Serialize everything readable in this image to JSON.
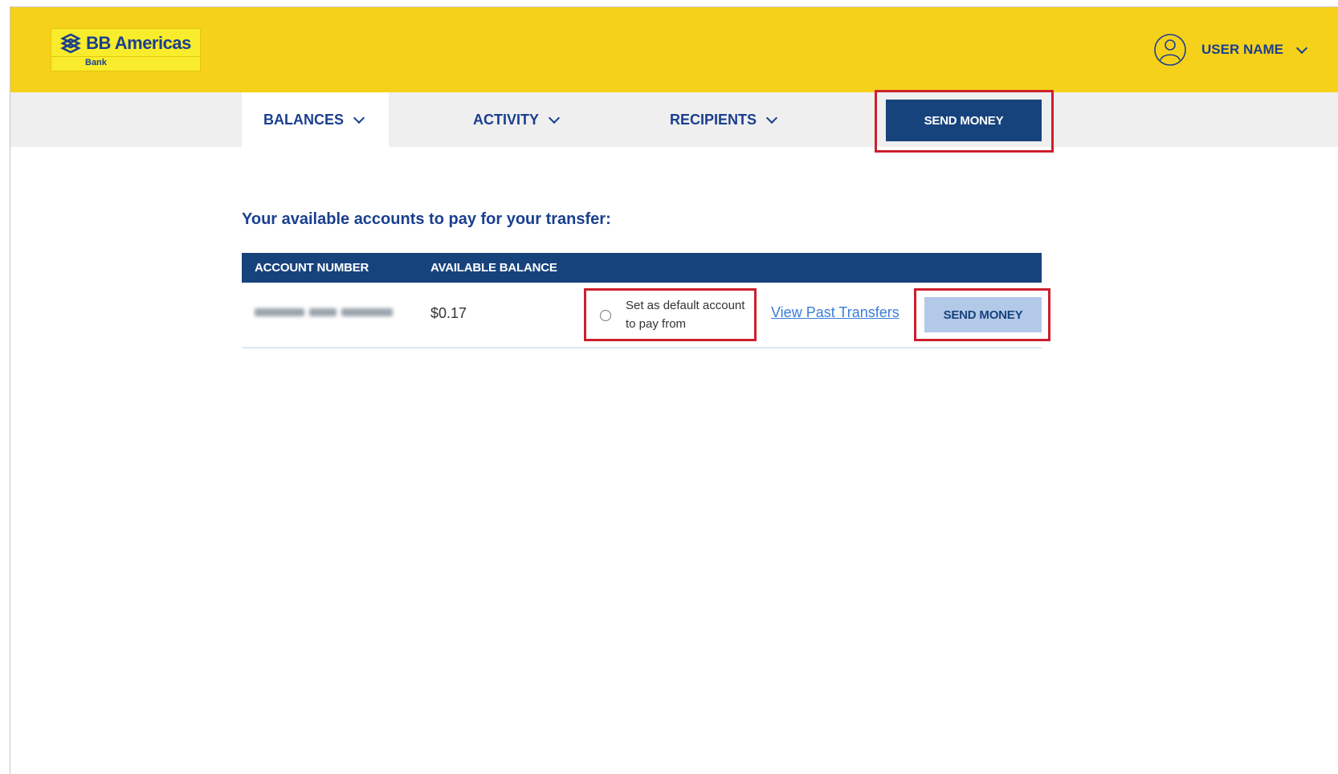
{
  "brand": {
    "name": "BB Americas",
    "sub": "Bank",
    "logo_icon": "bb-logo-mark-icon"
  },
  "user": {
    "name": "USER NAME",
    "icon": "user-avatar-icon"
  },
  "nav": {
    "tabs": [
      {
        "label": "BALANCES",
        "active": true
      },
      {
        "label": "ACTIVITY",
        "active": false
      },
      {
        "label": "RECIPIENTS",
        "active": false
      }
    ],
    "send_money_label": "SEND MONEY"
  },
  "main": {
    "heading": "Your available accounts to pay for your transfer:",
    "columns": [
      "ACCOUNT NUMBER",
      "AVAILABLE BALANCE"
    ],
    "rows": [
      {
        "balance": "$0.17",
        "default_label": "Set as default account to pay from",
        "default_selected": false,
        "link_label": "View Past Transfers",
        "send_label": "SEND MONEY"
      }
    ]
  },
  "colors": {
    "header_yellow": "#f6d11a",
    "brand_blue": "#17437d",
    "highlight_red": "#cc1f2d",
    "link_blue": "#3b7dd8"
  }
}
